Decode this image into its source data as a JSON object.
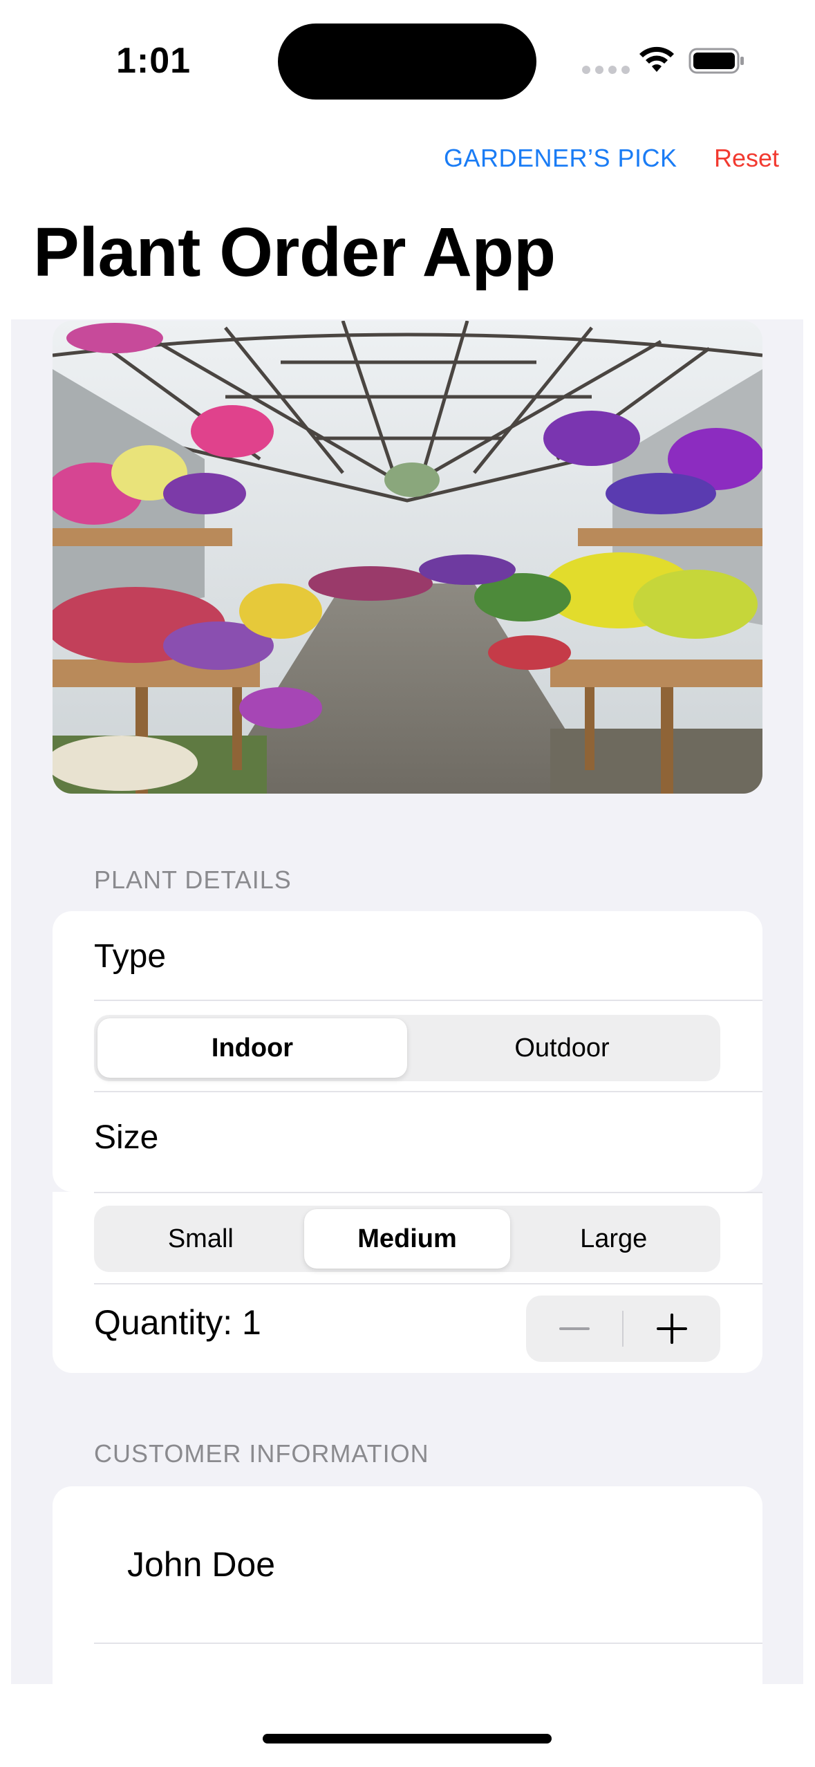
{
  "status_bar": {
    "time": "1:01"
  },
  "nav": {
    "gardener_pick_label": "GARDENER’S PICK",
    "reset_label": "Reset",
    "title": "Plant Order App"
  },
  "colors": {
    "accent": "#1a7cf5",
    "destructive": "#f23a30",
    "background": "#f2f2f7"
  },
  "plant_details": {
    "header": "PLANT DETAILS",
    "type_label": "Type",
    "type_options": [
      "Indoor",
      "Outdoor"
    ],
    "type_selected": "Indoor",
    "size_label": "Size",
    "size_options": [
      "Small",
      "Medium",
      "Large"
    ],
    "size_selected": "Medium",
    "quantity_text": "Quantity: 1"
  },
  "customer_information": {
    "header": "CUSTOMER INFORMATION",
    "name_value": "John Doe"
  }
}
